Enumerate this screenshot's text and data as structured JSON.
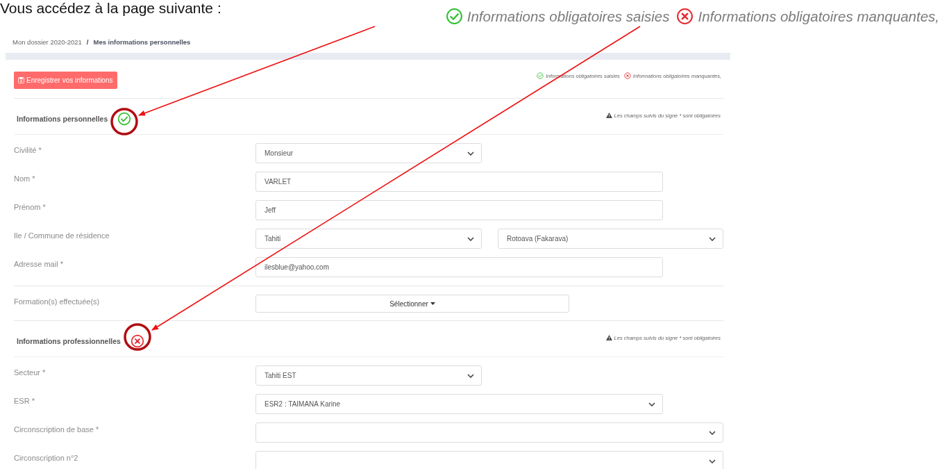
{
  "intro": "Vous accédez à la page suivante :",
  "legend_zoom": [
    {
      "kind": "ok",
      "text": "Informations obligatoires saisies"
    },
    {
      "kind": "missing",
      "text": "Informations obligatoires manquantes,"
    }
  ],
  "breadcrumb": {
    "separator": "/",
    "items": [
      {
        "label": "Mon dossier 2020-2021",
        "current": false
      },
      {
        "label": "Mes informations personnelles",
        "current": true
      }
    ]
  },
  "save_button": "Enregistrer vos informations",
  "legend": [
    {
      "kind": "ok",
      "text": "Informations obligatoires saisies"
    },
    {
      "kind": "missing",
      "text": "Informations obligatoires manquantes,"
    }
  ],
  "sections": [
    {
      "title": "Informations personnelles",
      "complete": true,
      "note": "Les champs suivis du signe * sont obligatoires",
      "fields": [
        {
          "label": "Civilité *",
          "kind": "select",
          "value": "Monsieur"
        },
        {
          "label": "Nom *",
          "kind": "input",
          "value": "VARLET"
        },
        {
          "label": "Prénom *",
          "kind": "input",
          "value": "Jeff"
        },
        {
          "label": "Ile / Commune de résidence",
          "kind": "select-pair",
          "value": "Tahiti",
          "value_2": "Rotoava (Fakarava)"
        },
        {
          "label": "Adresse mail *",
          "kind": "input",
          "value": "ilesblue@yahoo.com"
        },
        {
          "label": "Formation(s) effectuée(s)",
          "kind": "dropdown",
          "value": "Sélectionner"
        }
      ]
    },
    {
      "title": "Informations professionnelles",
      "complete": false,
      "note": "Les champs suivis du signe * sont obligatoires",
      "fields": [
        {
          "label": "Secteur *",
          "kind": "select",
          "value": "Tahiti EST"
        },
        {
          "label": "ESR *",
          "kind": "select",
          "value": "ESR2 : TAIMANA Karine"
        },
        {
          "label": "Circonscription de base *",
          "kind": "select"
        },
        {
          "label": "Circonscription n°2",
          "kind": "select"
        }
      ]
    }
  ]
}
